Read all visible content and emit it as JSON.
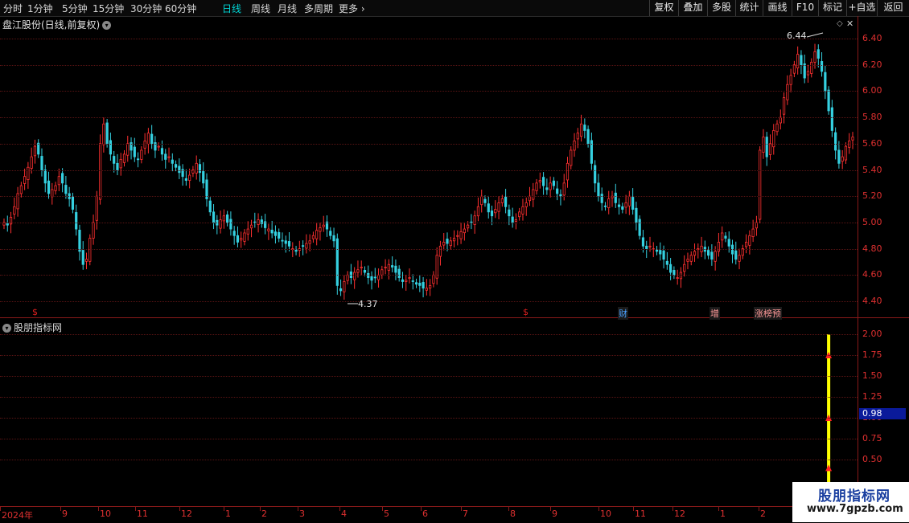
{
  "periods": [
    "分时",
    "1分钟",
    "5分钟",
    "15分钟",
    "30分钟",
    "60分钟",
    "日线",
    "周线",
    "月线",
    "多周期",
    "更多 ›"
  ],
  "active_period": "日线",
  "tools": [
    "复权",
    "叠加",
    "多股",
    "统计",
    "画线",
    "F10",
    "标记",
    "+自选",
    "返回"
  ],
  "main_title": "盘江股份(日线,前复权)",
  "main_yticks": [
    "6.40",
    "6.20",
    "6.00",
    "5.80",
    "5.60",
    "5.40",
    "5.20",
    "5.00",
    "4.80",
    "4.60",
    "4.40"
  ],
  "high_label": "6.44",
  "low_label": "4.37",
  "markers": [
    {
      "text": "$",
      "color": "#e02020"
    },
    {
      "text": "$",
      "color": "#e02020"
    },
    {
      "text": "财",
      "color": "#4aa0ff"
    },
    {
      "text": "增",
      "color": "#ff9a9a"
    },
    {
      "text": "涨榜预",
      "color": "#ff9a9a"
    }
  ],
  "indicator_title": "股朋指标网",
  "ind_yticks": [
    "2.00",
    "1.75",
    "1.50",
    "1.25",
    "1.00",
    "0.75",
    "0.50"
  ],
  "current_value": "0.98",
  "xaxis_labels": [
    "2024年",
    "9",
    "10",
    "11",
    "12",
    "1",
    "2",
    "3",
    "4",
    "5",
    "6",
    "7",
    "8",
    "9",
    "10",
    "11",
    "12",
    "1",
    "2"
  ],
  "watermark_title": "股朋指标网",
  "watermark_url": "www.7gpzb.com",
  "colors": {
    "up": "#ff3030",
    "down": "#35d0e0",
    "grid": "#5a1414",
    "axis": "#8a1a1a",
    "signal": "#ffff00"
  },
  "chart_data": {
    "type": "candlestick",
    "ylim": [
      4.37,
      6.44
    ],
    "closes": [
      5.0,
      4.98,
      5.04,
      5.12,
      5.22,
      5.28,
      5.35,
      5.42,
      5.5,
      5.58,
      5.52,
      5.4,
      5.3,
      5.22,
      5.25,
      5.28,
      5.35,
      5.3,
      5.22,
      5.18,
      5.1,
      4.95,
      4.78,
      4.68,
      4.72,
      4.88,
      5.0,
      5.2,
      5.6,
      5.75,
      5.6,
      5.52,
      5.45,
      5.4,
      5.48,
      5.52,
      5.6,
      5.55,
      5.5,
      5.48,
      5.55,
      5.62,
      5.68,
      5.6,
      5.55,
      5.58,
      5.52,
      5.48,
      5.5,
      5.45,
      5.42,
      5.38,
      5.35,
      5.32,
      5.36,
      5.4,
      5.45,
      5.38,
      5.3,
      5.18,
      5.08,
      5.0,
      4.98,
      5.02,
      5.05,
      5.0,
      4.95,
      4.9,
      4.85,
      4.88,
      4.92,
      4.95,
      4.98,
      5.0,
      5.02,
      4.99,
      4.96,
      4.95,
      4.92,
      4.9,
      4.88,
      4.86,
      4.84,
      4.82,
      4.8,
      4.78,
      4.8,
      4.82,
      4.84,
      4.86,
      4.9,
      4.94,
      4.96,
      4.98,
      4.95,
      4.9,
      4.86,
      4.52,
      4.48,
      4.55,
      4.6,
      4.58,
      4.62,
      4.64,
      4.66,
      4.62,
      4.58,
      4.56,
      4.58,
      4.6,
      4.64,
      4.66,
      4.68,
      4.66,
      4.62,
      4.58,
      4.55,
      4.56,
      4.58,
      4.55,
      4.53,
      4.52,
      4.5,
      4.5,
      4.52,
      4.6,
      4.75,
      4.82,
      4.85,
      4.84,
      4.86,
      4.88,
      4.9,
      4.93,
      4.95,
      4.98,
      5.0,
      5.05,
      5.12,
      5.2,
      5.15,
      5.08,
      5.05,
      5.1,
      5.15,
      5.18,
      5.12,
      5.05,
      5.0,
      5.02,
      5.08,
      5.12,
      5.15,
      5.2,
      5.25,
      5.3,
      5.32,
      5.28,
      5.25,
      5.3,
      5.28,
      5.22,
      5.2,
      5.3,
      5.45,
      5.55,
      5.62,
      5.68,
      5.75,
      5.7,
      5.6,
      5.45,
      5.3,
      5.2,
      5.15,
      5.12,
      5.18,
      5.2,
      5.15,
      5.12,
      5.1,
      5.15,
      5.2,
      5.1,
      5.0,
      4.9,
      4.82,
      4.8,
      4.82,
      4.8,
      4.78,
      4.76,
      4.72,
      4.68,
      4.62,
      4.6,
      4.58,
      4.62,
      4.68,
      4.72,
      4.75,
      4.78,
      4.8,
      4.82,
      4.78,
      4.75,
      4.72,
      4.78,
      4.85,
      4.92,
      4.88,
      4.82,
      4.76,
      4.72,
      4.75,
      4.8,
      4.85,
      4.9,
      4.95,
      5.0,
      5.55,
      5.65,
      5.5,
      5.6,
      5.7,
      5.75,
      5.8,
      5.95,
      6.05,
      6.12,
      6.2,
      6.28,
      6.2,
      6.1,
      6.15,
      6.22,
      6.3,
      6.25,
      6.15,
      6.0,
      5.85,
      5.7,
      5.55,
      5.45,
      5.5,
      5.58,
      5.62,
      5.65
    ],
    "signal_bar_index": 240,
    "signal_arrow_values": [
      1.75,
      1.0,
      0.4
    ],
    "ind_ylim": [
      0.3,
      2.1
    ]
  }
}
